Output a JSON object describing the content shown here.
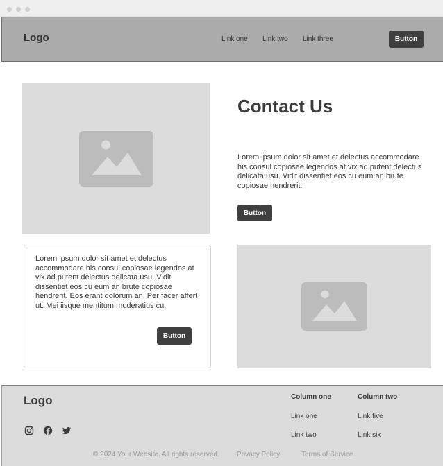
{
  "header": {
    "logo": "Logo",
    "nav": [
      "Link one",
      "Link two",
      "Link three"
    ],
    "button_label": "Button"
  },
  "hero": {
    "title": "Contact Us",
    "body": "Lorem ipsum dolor sit amet et delectus accommodare his consul copiosae legendos at vix ad putent delectus delicata usu. Vidit dissentiet eos cu eum an brute copiosae hendrerit.",
    "button_label": "Button",
    "image_icon": "image-placeholder-icon"
  },
  "card": {
    "body": "Lorem ipsum dolor sit amet et delectus accommodare his consul copiosae legendos at vix ad putent delectus delicata usu. Vidit dissentiet eos cu eum an brute copiosae hendrerit. Eos erant dolorum an. Per facer affert ut. Mei iisque mentitum moderatius cu.",
    "button_label": "Button"
  },
  "footer": {
    "logo": "Logo",
    "social_icons": [
      "instagram-icon",
      "facebook-icon",
      "twitter-icon"
    ],
    "columns": [
      {
        "title": "Column one",
        "links": [
          "Link one",
          "Link two"
        ]
      },
      {
        "title": "Column two",
        "links": [
          "Link five",
          "Link six"
        ]
      }
    ],
    "copyright": "© 2024 Your Website. All rights reserved.",
    "privacy": "Privacy Policy",
    "terms": "Terms of Service"
  },
  "colors": {
    "navbar_bg": "#ababab",
    "button_bg": "#3f3f3f",
    "placeholder_bg": "#dcdcdc",
    "placeholder_icon": "#bcbcbc",
    "footer_bg": "#dcdcdc"
  }
}
